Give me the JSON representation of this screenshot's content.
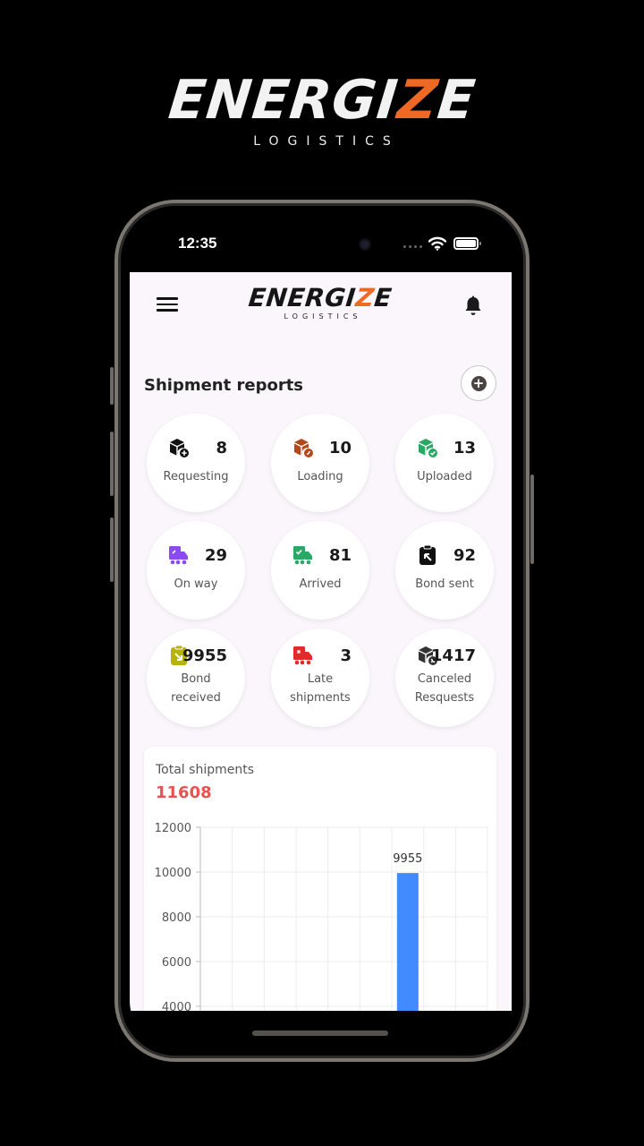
{
  "brand": {
    "name_prefix": "ENERGI",
    "name_accent": "Z",
    "name_suffix": "E",
    "tagline": "LOGISTICS",
    "accent_color": "#ee6a24"
  },
  "status_bar": {
    "time": "12:35",
    "icons": [
      "cellular-dots-icon",
      "wifi-icon",
      "battery-icon"
    ]
  },
  "app_header": {
    "menu_icon": "hamburger-menu-icon",
    "notification_icon": "bell-icon",
    "logo_prefix": "ENERGI",
    "logo_accent": "Z",
    "logo_suffix": "E",
    "logo_tagline": "LOGISTICS"
  },
  "section": {
    "title": "Shipment reports",
    "add_icon": "plus-circle-icon"
  },
  "reports": [
    {
      "label": "Requesting",
      "count": "8",
      "icon": "box-plus-icon",
      "color": "#111111"
    },
    {
      "label": "Loading",
      "count": "10",
      "icon": "box-loading-icon",
      "color": "#b5481a"
    },
    {
      "label": "Uploaded",
      "count": "13",
      "icon": "box-check-icon",
      "color": "#2aa866"
    },
    {
      "label": "On way",
      "count": "29",
      "icon": "truck-moving-icon",
      "color": "#8a4bf0"
    },
    {
      "label": "Arrived",
      "count": "81",
      "icon": "truck-check-icon",
      "color": "#2aa866"
    },
    {
      "label": "Bond sent",
      "count": "92",
      "icon": "clipboard-arrow-up-icon",
      "color": "#111111"
    },
    {
      "label": "Bond received",
      "count": "9955",
      "icon": "clipboard-arrow-down-icon",
      "color": "#b8b20c",
      "label_lines": [
        "Bond",
        "received"
      ]
    },
    {
      "label": "Late shipments",
      "count": "3",
      "icon": "truck-alert-icon",
      "color": "#e22a2a",
      "label_lines": [
        "Late",
        "shipments"
      ]
    },
    {
      "label": "Canceled Resquests",
      "count": "1417",
      "icon": "box-cancel-icon",
      "color": "#333333",
      "label_lines": [
        "Canceled",
        "Resquests"
      ]
    }
  ],
  "total": {
    "label": "Total shipments",
    "value": "11608",
    "color": "#e8524f"
  },
  "chart_data": {
    "type": "bar",
    "title": "Total shipments",
    "categories": [
      "",
      "",
      "",
      "",
      "",
      "",
      "",
      "",
      ""
    ],
    "values": [
      0,
      0,
      0,
      0,
      0,
      0,
      9955,
      0,
      0
    ],
    "data_labels": [
      "",
      "",
      "",
      "",
      "",
      "",
      "9955",
      "",
      ""
    ],
    "y_ticks": [
      4000,
      6000,
      8000,
      10000,
      12000
    ],
    "ylim": [
      4000,
      12000
    ],
    "bar_color": "#428bff",
    "grid": true,
    "xlabel": "",
    "ylabel": ""
  }
}
